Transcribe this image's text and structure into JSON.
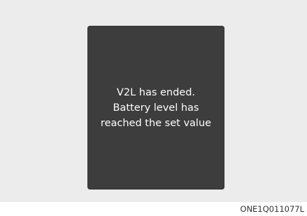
{
  "display": {
    "message_lines": [
      "V2L has ended.",
      "Battery level has",
      "reached the set value"
    ]
  },
  "figure": {
    "code": "ONE1Q011077L"
  },
  "colors": {
    "background": "#ececec",
    "screen": "#3d3d3d",
    "text": "#ffffff"
  }
}
